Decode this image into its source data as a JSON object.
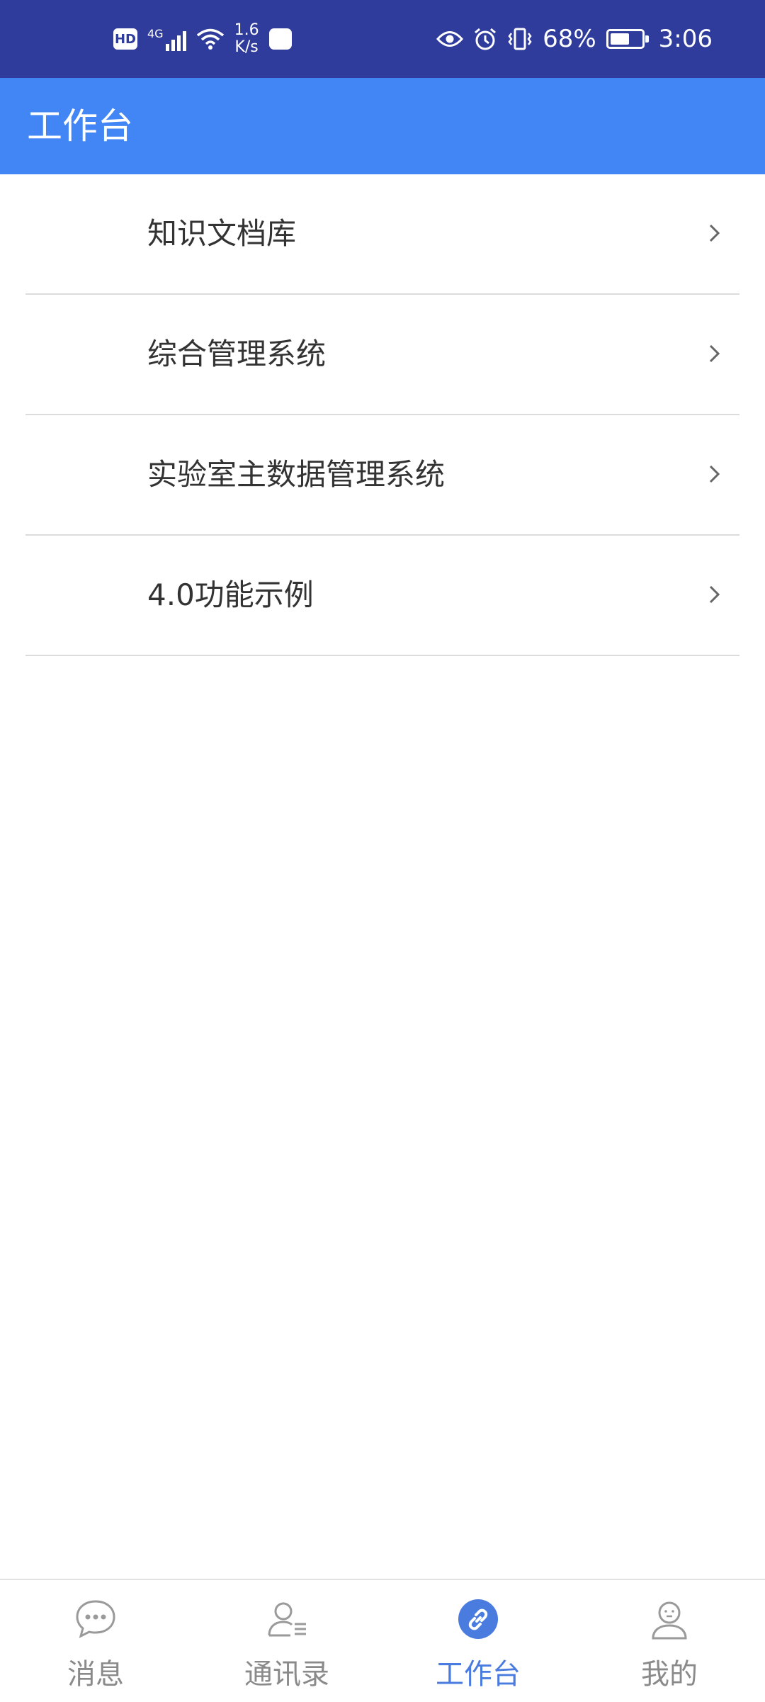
{
  "status_bar": {
    "hd": "HD",
    "network": "4G",
    "speed_value": "1.6",
    "speed_unit": "K/s",
    "battery_percent": "68%",
    "battery_level": 0.68,
    "time": "3:06"
  },
  "app_bar": {
    "title": "工作台",
    "color": "#4285f4"
  },
  "menu": [
    {
      "label": "知识文档库",
      "icon": "chevron-right-icon"
    },
    {
      "label": "综合管理系统",
      "icon": "chevron-right-icon"
    },
    {
      "label": "实验室主数据管理系统",
      "icon": "chevron-right-icon"
    },
    {
      "label": "4.0功能示例",
      "icon": "chevron-right-icon"
    }
  ],
  "bottom_nav": [
    {
      "label": "消息",
      "icon": "chat-bubble-icon",
      "active": false
    },
    {
      "label": "通讯录",
      "icon": "contacts-icon",
      "active": false
    },
    {
      "label": "工作台",
      "icon": "link-icon",
      "active": true
    },
    {
      "label": "我的",
      "icon": "user-icon",
      "active": false
    }
  ],
  "colors": {
    "status_bar": "#2f3c9c",
    "accent": "#4a7ce0",
    "inactive": "#8a8a8a"
  }
}
